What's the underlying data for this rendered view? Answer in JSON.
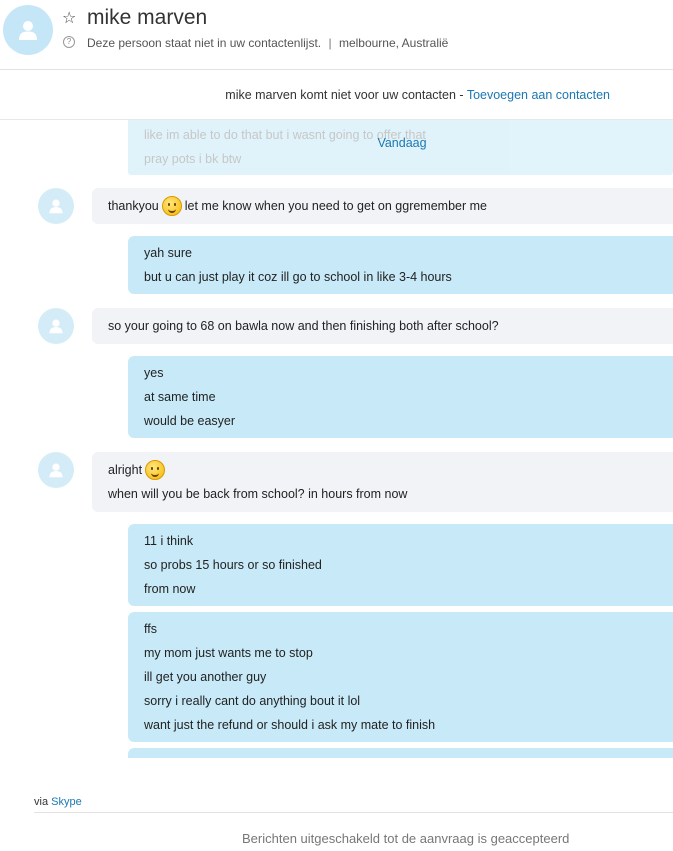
{
  "header": {
    "contact_name": "mike marven",
    "status_text": "Deze persoon staat niet in uw contactenlijst.",
    "separator": "|",
    "location": "melbourne, Australië",
    "star_icon": "star-outline-icon",
    "info_icon": "help-circle-icon"
  },
  "notice": {
    "text": "mike marven komt niet voor uw contacten - ",
    "link_label": "Toevoegen aan contacten"
  },
  "chat": {
    "ghost_lines": [
      "like im able to do that but i wasnt going to offer that",
      "pray pots i bk btw"
    ],
    "day_label": "Vandaag",
    "messages": [
      {
        "from": "them",
        "lines": [
          {
            "before": "thankyou",
            "after": "let me know when you need to get on ggremember me"
          }
        ]
      },
      {
        "from": "me",
        "lines": [
          "yah sure",
          "but u can just play it coz ill go to school in like 3-4 hours"
        ]
      },
      {
        "from": "them",
        "lines": [
          "so your going to 68 on bawla now and then finishing both after school?"
        ]
      },
      {
        "from": "me",
        "lines": [
          "yes",
          "at same time",
          "would be easyer"
        ]
      },
      {
        "from": "them",
        "lines": [
          {
            "before": "alright",
            "after": ""
          },
          "when will you be back from school? in hours from now"
        ]
      },
      {
        "from": "me",
        "lines": [
          "11 i think",
          "so probs 15 hours or so finished",
          "from now"
        ]
      },
      {
        "from": "me",
        "lines": [
          "ffs",
          "my mom just wants me to stop",
          "ill get you another guy",
          "sorry i really cant do anything bout it lol",
          "want just the refund or should i ask my mate to finish"
        ]
      }
    ]
  },
  "footer": {
    "via_prefix": "via ",
    "via_link": "Skype",
    "disabled_text": "Berichten uitgeschakeld tot de aanvraag is geaccepteerd"
  },
  "colors": {
    "accent": "#1b78b2",
    "outgoing_bubble": "#c8eaf8",
    "incoming_bubble": "#f1f3f7",
    "avatar": "#c5e6f7"
  }
}
